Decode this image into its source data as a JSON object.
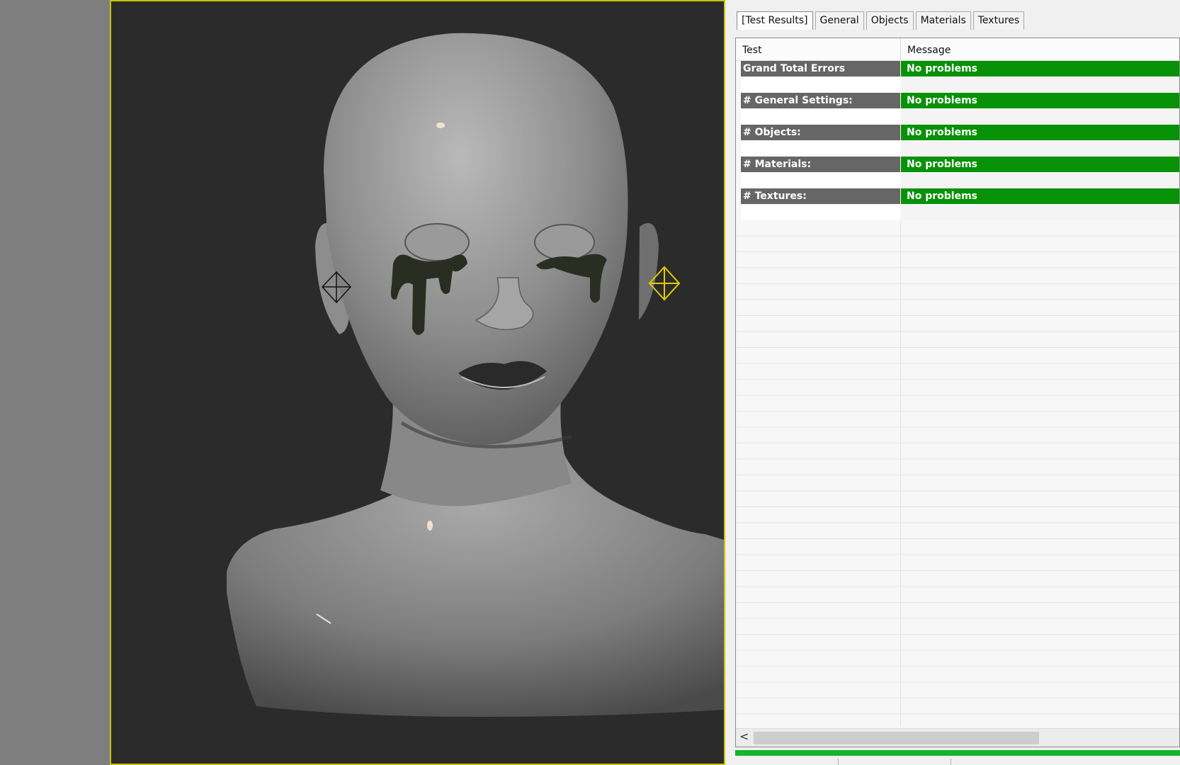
{
  "tabs": [
    {
      "label": "[Test Results]",
      "active": true
    },
    {
      "label": "General",
      "active": false
    },
    {
      "label": "Objects",
      "active": false
    },
    {
      "label": "Materials",
      "active": false
    },
    {
      "label": "Textures",
      "active": false
    }
  ],
  "table": {
    "columns": [
      "Test",
      "Message"
    ],
    "rows": [
      {
        "test": "Grand Total Errors",
        "message": "No problems"
      },
      {
        "test": "# General Settings:",
        "message": "No problems"
      },
      {
        "test": "# Objects:",
        "message": "No problems"
      },
      {
        "test": "# Materials:",
        "message": "No problems"
      },
      {
        "test": "# Textures:",
        "message": "No problems"
      }
    ]
  },
  "scrollbar": {
    "left_arrow": "<"
  },
  "progress": {
    "fraction": 1.0
  },
  "colors": {
    "viewport_bg": "#2b2b2b",
    "viewport_border": "#c9c400",
    "label_cell": "#666666",
    "ok_cell": "#079207",
    "progress": "#14b42c"
  },
  "viewport": {
    "content": "3d-head-bust-model",
    "light_selected_color": "#e0cc00"
  }
}
